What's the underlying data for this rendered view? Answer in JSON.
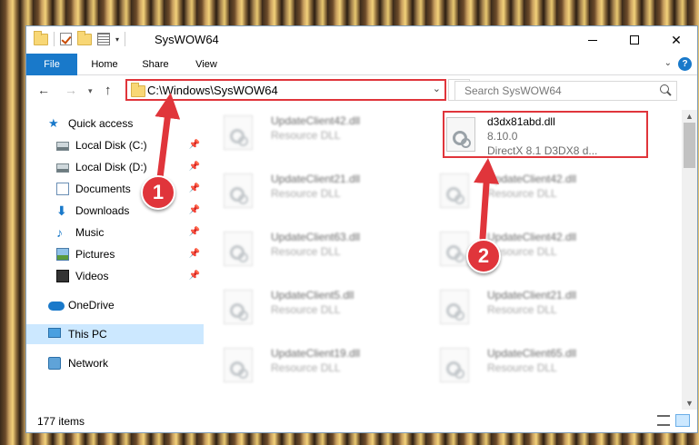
{
  "window": {
    "title": "SysWOW64"
  },
  "ribbon": {
    "tabs": [
      {
        "label": "File"
      },
      {
        "label": "Home"
      },
      {
        "label": "Share"
      },
      {
        "label": "View"
      }
    ],
    "help_label": "?"
  },
  "navbar": {
    "address": "C:\\Windows\\SysWOW64",
    "search_placeholder": "Search SysWOW64"
  },
  "sidebar": {
    "items": [
      {
        "label": "Quick access",
        "icon": "star-icon"
      },
      {
        "label": "Local Disk (C:)",
        "icon": "disk-icon"
      },
      {
        "label": "Local Disk (D:)",
        "icon": "disk-icon"
      },
      {
        "label": "Documents",
        "icon": "documents-icon"
      },
      {
        "label": "Downloads",
        "icon": "downloads-icon"
      },
      {
        "label": "Music",
        "icon": "music-icon"
      },
      {
        "label": "Pictures",
        "icon": "pictures-icon"
      },
      {
        "label": "Videos",
        "icon": "videos-icon"
      },
      {
        "label": "OneDrive",
        "icon": "cloud-icon"
      },
      {
        "label": "This PC",
        "icon": "pc-icon"
      },
      {
        "label": "Network",
        "icon": "network-icon"
      }
    ]
  },
  "files": [
    {
      "name": "UpdateClient42.dll",
      "type": "Resource DLL"
    },
    {
      "name": "d3dx81abd.dll",
      "version": "8.10.0",
      "description": "DirectX 8.1 D3DX8 d..."
    },
    {
      "name": "UpdateClient21.dll",
      "type": "Resource DLL"
    },
    {
      "name": "UpdateClient42.dll",
      "type": "Resource DLL"
    },
    {
      "name": "UpdateClient63.dll",
      "type": "Resource DLL"
    },
    {
      "name": "UpdateClient42.dll",
      "type": "Resource DLL"
    },
    {
      "name": "UpdateClient5.dll",
      "type": "Resource DLL"
    },
    {
      "name": "UpdateClient21.dll",
      "type": "Resource DLL"
    },
    {
      "name": "UpdateClient19.dll",
      "type": "Resource DLL"
    },
    {
      "name": "UpdateClient65.dll",
      "type": "Resource DLL"
    }
  ],
  "status": {
    "item_count": "177 items"
  },
  "callouts": [
    "1",
    "2"
  ],
  "colors": {
    "accent": "#1979ca",
    "highlight": "#e0353b",
    "selected": "#cce8ff"
  }
}
